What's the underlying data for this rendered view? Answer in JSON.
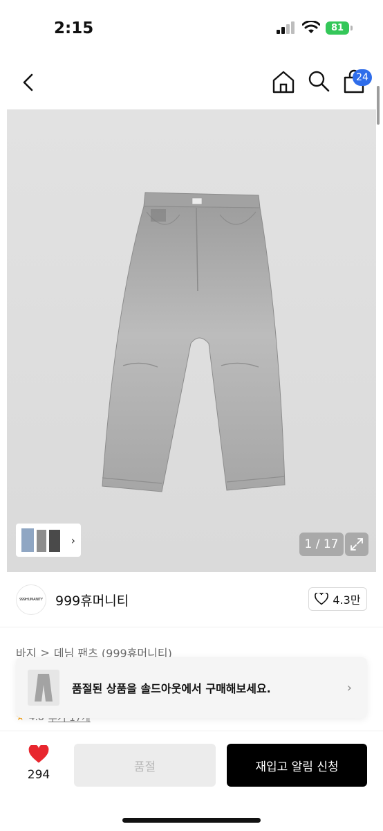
{
  "status_bar": {
    "time": "2:15",
    "battery": "81"
  },
  "nav": {
    "cart_count": "24"
  },
  "gallery": {
    "counter": "1 / 17",
    "thumbnail_arrow": "›"
  },
  "brand": {
    "logo_text": "999HUMANITY",
    "name": "999휴머니티",
    "likes": "4.3만"
  },
  "breadcrumb": {
    "category": "바지",
    "separator": ">",
    "subcategory": "데님 팬츠 (999휴머니티)"
  },
  "rating": {
    "score": "4.8",
    "link": "후기 17개"
  },
  "soldout_banner": {
    "text": "품절된 상품을 솔드아웃에서 구매해보세요.",
    "arrow": "›"
  },
  "bottom_bar": {
    "fav_count": "294",
    "soldout_label": "품절",
    "restock_label": "재입고 알림 신청"
  },
  "colors": {
    "accent_blue": "#2f6dea",
    "battery_green": "#34c759",
    "heart_red": "#e8262e",
    "primary_black": "#000000"
  }
}
